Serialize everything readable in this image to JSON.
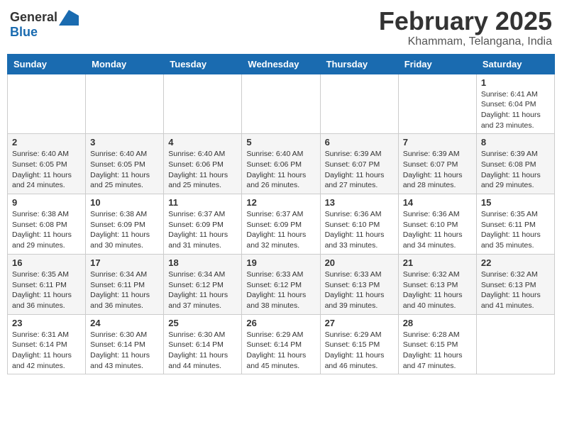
{
  "header": {
    "logo_general": "General",
    "logo_blue": "Blue",
    "month_title": "February 2025",
    "location": "Khammam, Telangana, India"
  },
  "weekdays": [
    "Sunday",
    "Monday",
    "Tuesday",
    "Wednesday",
    "Thursday",
    "Friday",
    "Saturday"
  ],
  "weeks": [
    [
      {
        "day": "",
        "info": ""
      },
      {
        "day": "",
        "info": ""
      },
      {
        "day": "",
        "info": ""
      },
      {
        "day": "",
        "info": ""
      },
      {
        "day": "",
        "info": ""
      },
      {
        "day": "",
        "info": ""
      },
      {
        "day": "1",
        "info": "Sunrise: 6:41 AM\nSunset: 6:04 PM\nDaylight: 11 hours\nand 23 minutes."
      }
    ],
    [
      {
        "day": "2",
        "info": "Sunrise: 6:40 AM\nSunset: 6:05 PM\nDaylight: 11 hours\nand 24 minutes."
      },
      {
        "day": "3",
        "info": "Sunrise: 6:40 AM\nSunset: 6:05 PM\nDaylight: 11 hours\nand 25 minutes."
      },
      {
        "day": "4",
        "info": "Sunrise: 6:40 AM\nSunset: 6:06 PM\nDaylight: 11 hours\nand 25 minutes."
      },
      {
        "day": "5",
        "info": "Sunrise: 6:40 AM\nSunset: 6:06 PM\nDaylight: 11 hours\nand 26 minutes."
      },
      {
        "day": "6",
        "info": "Sunrise: 6:39 AM\nSunset: 6:07 PM\nDaylight: 11 hours\nand 27 minutes."
      },
      {
        "day": "7",
        "info": "Sunrise: 6:39 AM\nSunset: 6:07 PM\nDaylight: 11 hours\nand 28 minutes."
      },
      {
        "day": "8",
        "info": "Sunrise: 6:39 AM\nSunset: 6:08 PM\nDaylight: 11 hours\nand 29 minutes."
      }
    ],
    [
      {
        "day": "9",
        "info": "Sunrise: 6:38 AM\nSunset: 6:08 PM\nDaylight: 11 hours\nand 29 minutes."
      },
      {
        "day": "10",
        "info": "Sunrise: 6:38 AM\nSunset: 6:09 PM\nDaylight: 11 hours\nand 30 minutes."
      },
      {
        "day": "11",
        "info": "Sunrise: 6:37 AM\nSunset: 6:09 PM\nDaylight: 11 hours\nand 31 minutes."
      },
      {
        "day": "12",
        "info": "Sunrise: 6:37 AM\nSunset: 6:09 PM\nDaylight: 11 hours\nand 32 minutes."
      },
      {
        "day": "13",
        "info": "Sunrise: 6:36 AM\nSunset: 6:10 PM\nDaylight: 11 hours\nand 33 minutes."
      },
      {
        "day": "14",
        "info": "Sunrise: 6:36 AM\nSunset: 6:10 PM\nDaylight: 11 hours\nand 34 minutes."
      },
      {
        "day": "15",
        "info": "Sunrise: 6:35 AM\nSunset: 6:11 PM\nDaylight: 11 hours\nand 35 minutes."
      }
    ],
    [
      {
        "day": "16",
        "info": "Sunrise: 6:35 AM\nSunset: 6:11 PM\nDaylight: 11 hours\nand 36 minutes."
      },
      {
        "day": "17",
        "info": "Sunrise: 6:34 AM\nSunset: 6:11 PM\nDaylight: 11 hours\nand 36 minutes."
      },
      {
        "day": "18",
        "info": "Sunrise: 6:34 AM\nSunset: 6:12 PM\nDaylight: 11 hours\nand 37 minutes."
      },
      {
        "day": "19",
        "info": "Sunrise: 6:33 AM\nSunset: 6:12 PM\nDaylight: 11 hours\nand 38 minutes."
      },
      {
        "day": "20",
        "info": "Sunrise: 6:33 AM\nSunset: 6:13 PM\nDaylight: 11 hours\nand 39 minutes."
      },
      {
        "day": "21",
        "info": "Sunrise: 6:32 AM\nSunset: 6:13 PM\nDaylight: 11 hours\nand 40 minutes."
      },
      {
        "day": "22",
        "info": "Sunrise: 6:32 AM\nSunset: 6:13 PM\nDaylight: 11 hours\nand 41 minutes."
      }
    ],
    [
      {
        "day": "23",
        "info": "Sunrise: 6:31 AM\nSunset: 6:14 PM\nDaylight: 11 hours\nand 42 minutes."
      },
      {
        "day": "24",
        "info": "Sunrise: 6:30 AM\nSunset: 6:14 PM\nDaylight: 11 hours\nand 43 minutes."
      },
      {
        "day": "25",
        "info": "Sunrise: 6:30 AM\nSunset: 6:14 PM\nDaylight: 11 hours\nand 44 minutes."
      },
      {
        "day": "26",
        "info": "Sunrise: 6:29 AM\nSunset: 6:14 PM\nDaylight: 11 hours\nand 45 minutes."
      },
      {
        "day": "27",
        "info": "Sunrise: 6:29 AM\nSunset: 6:15 PM\nDaylight: 11 hours\nand 46 minutes."
      },
      {
        "day": "28",
        "info": "Sunrise: 6:28 AM\nSunset: 6:15 PM\nDaylight: 11 hours\nand 47 minutes."
      },
      {
        "day": "",
        "info": ""
      }
    ]
  ]
}
